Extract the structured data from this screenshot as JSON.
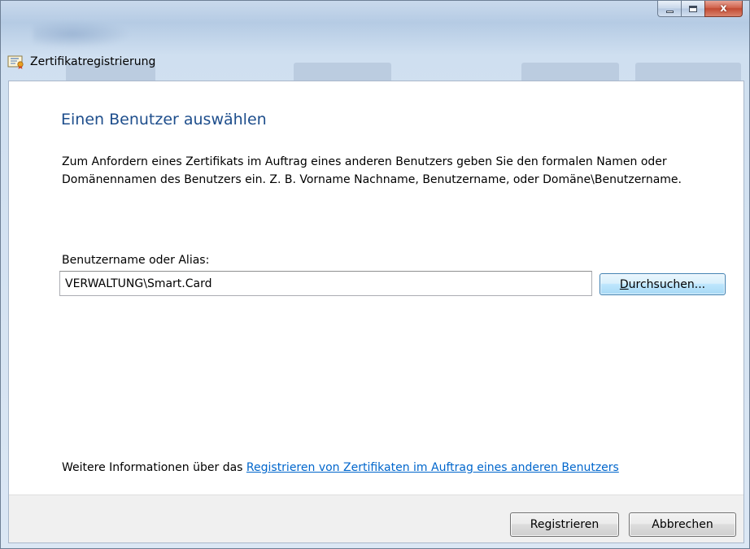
{
  "window": {
    "title": "Zertifikatregistrierung",
    "caption_buttons": {
      "minimize_icon": "minimize-icon",
      "maximize_icon": "maximize-icon",
      "close_glyph": "x"
    }
  },
  "page": {
    "heading": "Einen Benutzer auswählen",
    "description": "Zum Anfordern eines Zertifikats im Auftrag eines anderen Benutzers geben Sie den formalen Namen oder Domänennamen des Benutzers ein. Z. B. Vorname Nachname, Benutzername, oder Domäne\\Benutzername.",
    "field_label": "Benutzername oder Alias:",
    "field_value": "VERWALTUNG\\Smart.Card",
    "browse_button": {
      "accel": "D",
      "rest": "urchsuchen..."
    },
    "info_prefix": "Weitere Informationen über das ",
    "info_link": "Registrieren von Zertifikaten im Auftrag eines anderen Benutzers"
  },
  "footer": {
    "register_label": "Registrieren",
    "cancel_label": "Abbrechen"
  },
  "colors": {
    "heading": "#1e4e8c",
    "link": "#0066cc",
    "close_button": "#c24a33"
  }
}
